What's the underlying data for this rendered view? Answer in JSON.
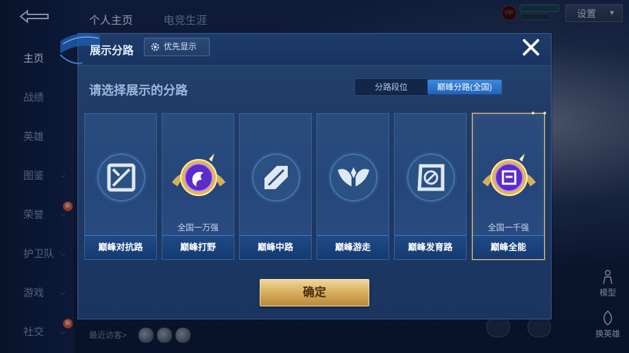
{
  "background": {
    "top_tabs": [
      "个人主页",
      "电竞生涯"
    ],
    "left_nav": [
      {
        "label": "主页",
        "active": true,
        "chevron": false,
        "hot": false
      },
      {
        "label": "战绩",
        "active": false,
        "chevron": false,
        "hot": false
      },
      {
        "label": "英雄",
        "active": false,
        "chevron": false,
        "hot": false
      },
      {
        "label": "图鉴",
        "active": false,
        "chevron": true,
        "hot": false
      },
      {
        "label": "荣誉",
        "active": false,
        "chevron": true,
        "hot": true
      },
      {
        "label": "护卫队",
        "active": false,
        "chevron": true,
        "hot": false
      },
      {
        "label": "游戏",
        "active": false,
        "chevron": true,
        "hot": false
      },
      {
        "label": "社交",
        "active": false,
        "chevron": true,
        "hot": true
      }
    ],
    "hot_badge": "新",
    "vip_label": "VIP",
    "settings_label": "设置",
    "recent_visitors_label": "最近访客>",
    "side_buttons": {
      "model": "模型",
      "change_hero": "换英雄"
    }
  },
  "modal": {
    "title": "展示分路",
    "priority_button": "优先显示",
    "subtitle": "请选择展示的分路",
    "toggle": {
      "left": "分路段位",
      "right": "巅峰分路(全国)",
      "selected": "right"
    },
    "lanes": [
      {
        "label": "巅峰对抗路",
        "rank": "",
        "emblem": "clash-lane-icon",
        "style": "silver",
        "selected": false
      },
      {
        "label": "巅峰打野",
        "rank": "全国一万强",
        "emblem": "jungle-gold-emblem",
        "style": "gold",
        "selected": false
      },
      {
        "label": "巅峰中路",
        "rank": "",
        "emblem": "mid-lane-icon",
        "style": "silver",
        "selected": false
      },
      {
        "label": "巅峰游走",
        "rank": "",
        "emblem": "roam-lane-icon",
        "style": "silver",
        "selected": false
      },
      {
        "label": "巅峰发育路",
        "rank": "",
        "emblem": "farm-lane-icon",
        "style": "silver",
        "selected": false
      },
      {
        "label": "巅峰全能",
        "rank": "全国一千强",
        "emblem": "allround-gold-emblem",
        "style": "gold",
        "selected": true
      }
    ],
    "confirm_label": "确定"
  },
  "colors": {
    "accent_blue": "#1f62b8",
    "gold": "#d6ad5c",
    "selected_border": "#e7c27e",
    "modal_bg": "#21406c"
  }
}
